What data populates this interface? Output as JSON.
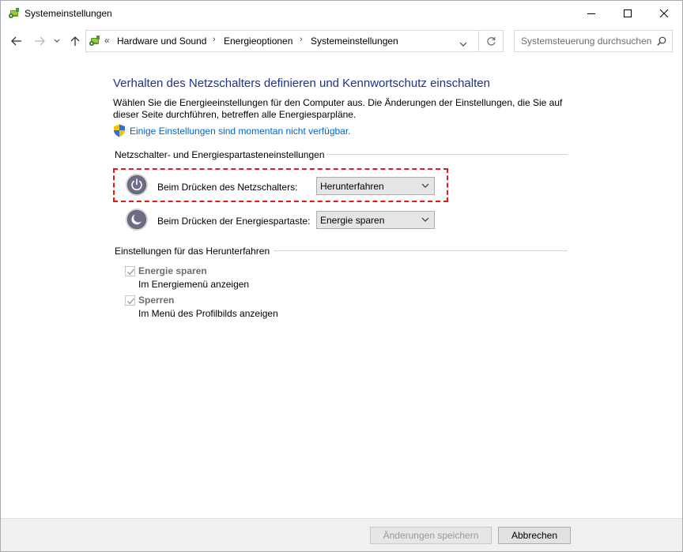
{
  "window": {
    "title": "Systemeinstellungen"
  },
  "address": {
    "crumbs": [
      "Hardware und Sound",
      "Energieoptionen",
      "Systemeinstellungen"
    ],
    "overflow": "«"
  },
  "search": {
    "placeholder": "Systemsteuerung durchsuchen"
  },
  "main": {
    "heading": "Verhalten des Netzschalters definieren und Kennwortschutz einschalten",
    "description": "Wählen Sie die Energieeinstellungen für den Computer aus. Die Änderungen der Einstellungen, die Sie auf dieser Seite durchführen, betreffen alle Energiesparpläne.",
    "unavailable_link": "Einige Einstellungen sind momentan nicht verfügbar."
  },
  "buttons_section": {
    "title": "Netzschalter- und Energiespartasteneinstellungen",
    "power_button": {
      "label": "Beim Drücken des Netzschalters:",
      "value": "Herunterfahren"
    },
    "sleep_button": {
      "label": "Beim Drücken der Energiespartaste:",
      "value": "Energie sparen"
    }
  },
  "shutdown_section": {
    "title": "Einstellungen für das Herunterfahren",
    "items": [
      {
        "label": "Energie sparen",
        "sub": "Im Energiemenü anzeigen",
        "checked": true
      },
      {
        "label": "Sperren",
        "sub": "Im Menü des Profilbilds anzeigen",
        "checked": true
      }
    ]
  },
  "footer": {
    "save_label": "Änderungen speichern",
    "cancel_label": "Abbrechen"
  },
  "colors": {
    "heading": "#1e3287",
    "link": "#0066cc",
    "highlight": "#e81818"
  }
}
